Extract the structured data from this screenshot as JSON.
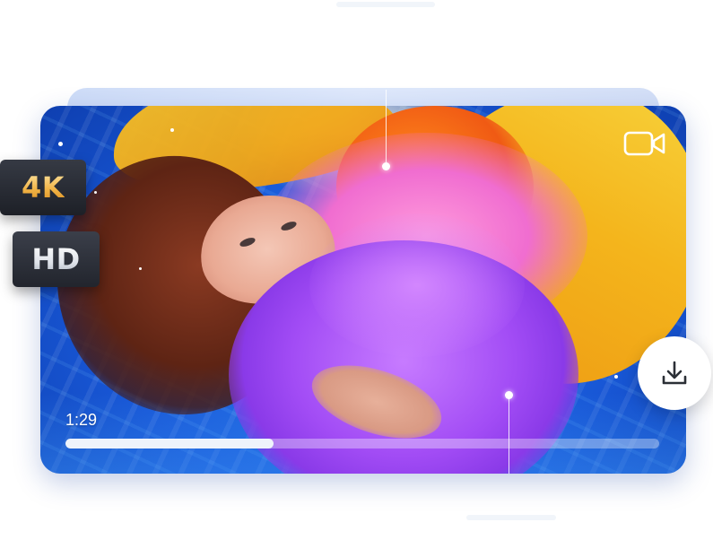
{
  "badges": {
    "quality_4k": "4K",
    "quality_hd": "HD"
  },
  "player": {
    "timecode": "1:29",
    "progress": 0.35
  },
  "icons": {
    "camera": "video-camera-icon",
    "download": "download-icon"
  },
  "colors": {
    "pool_blue": "#1857d6",
    "badge_dark": "#22252d",
    "gold_text": "#f1b447",
    "progress_fill": "#eef3fb"
  }
}
